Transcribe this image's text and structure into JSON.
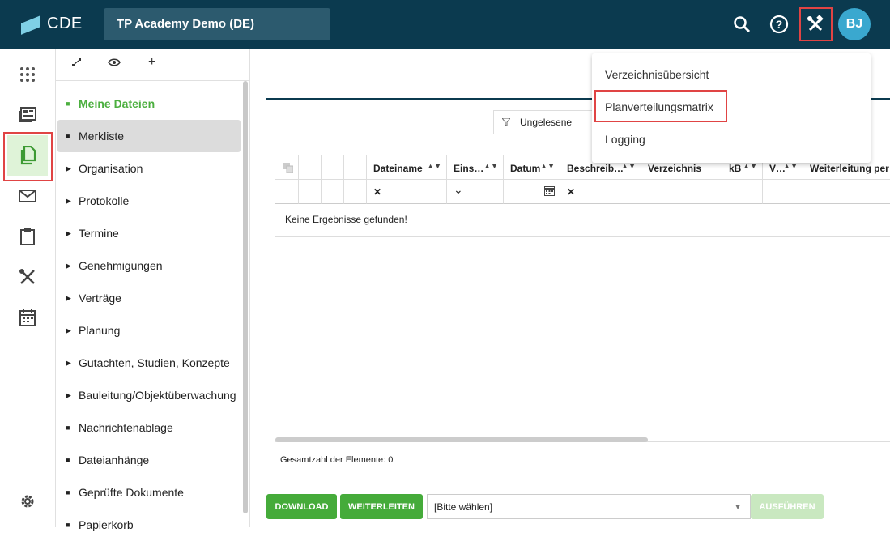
{
  "header": {
    "logo_text": "CDE",
    "project": "TP Academy Demo (DE)",
    "avatar": "BJ",
    "icons": [
      "search-icon",
      "help-icon",
      "tools-icon"
    ]
  },
  "tree": {
    "toolbar": {
      "expand": "expand-icon",
      "view": "eye-icon",
      "add": "+"
    },
    "items": [
      {
        "label": "Meine Dateien",
        "type": "leaf",
        "state": "active"
      },
      {
        "label": "Merkliste",
        "type": "leaf",
        "state": "selected"
      },
      {
        "label": "Organisation",
        "type": "folder"
      },
      {
        "label": "Protokolle",
        "type": "folder"
      },
      {
        "label": "Termine",
        "type": "folder"
      },
      {
        "label": "Genehmigungen",
        "type": "folder"
      },
      {
        "label": "Verträge",
        "type": "folder"
      },
      {
        "label": "Planung",
        "type": "folder"
      },
      {
        "label": "Gutachten, Studien, Konzepte",
        "type": "folder"
      },
      {
        "label": "Bauleitung/Objektüberwachung",
        "type": "folder"
      },
      {
        "label": "Nachrichtenablage",
        "type": "leaf"
      },
      {
        "label": "Dateianhänge",
        "type": "leaf"
      },
      {
        "label": "Geprüfte Dokumente",
        "type": "leaf"
      },
      {
        "label": "Papierkorb",
        "type": "leaf"
      }
    ]
  },
  "filter": {
    "label": "Ungelesene"
  },
  "grid": {
    "columns": [
      "Dateiname",
      "Eins…",
      "Datum",
      "Beschreib…",
      "Verzeichnis",
      "kB",
      "V…",
      "Weiterleitung per"
    ],
    "empty_message": "Keine Ergebnisse gefunden!",
    "filter_clear": "✕",
    "filter_dropdown": "⌄"
  },
  "total": "Gesamtzahl der Elemente: 0",
  "actions": {
    "download": "DOWNLOAD",
    "forward": "WEITERLEITEN",
    "select_placeholder": "[Bitte wählen]",
    "execute": "AUSFÜHREN"
  },
  "menu": {
    "items": [
      "Verzeichnisübersicht",
      "Planverteilungsmatrix",
      "Logging"
    ]
  },
  "colors": {
    "topbar": "#0b3a4f",
    "accent_green": "#4caf3f",
    "highlight": "#e04444"
  }
}
